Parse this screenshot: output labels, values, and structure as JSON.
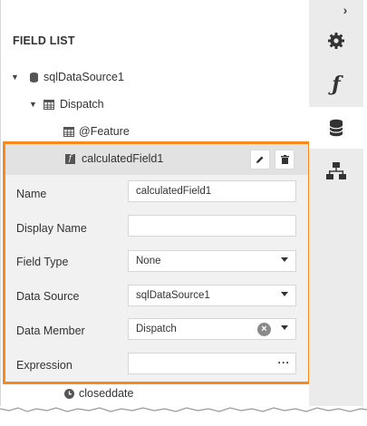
{
  "panel": {
    "title": "FIELD LIST"
  },
  "tree": {
    "datasource": "sqlDataSource1",
    "query": "Dispatch",
    "feature_field": "@Feature",
    "calculated_field": "calculatedField1",
    "closeddate_field": "closeddate"
  },
  "editor": {
    "name_label": "Name",
    "name_value": "calculatedField1",
    "display_name_label": "Display Name",
    "display_name_value": "",
    "field_type_label": "Field Type",
    "field_type_value": "None",
    "data_source_label": "Data Source",
    "data_source_value": "sqlDataSource1",
    "data_member_label": "Data Member",
    "data_member_value": "Dispatch",
    "expression_label": "Expression",
    "expression_value": "",
    "ellipsis": "···"
  },
  "sidebar": {
    "collapse_glyph": "›",
    "items": [
      "gear-icon",
      "function-icon",
      "database-icon",
      "hierarchy-icon"
    ],
    "active": "database-icon"
  },
  "colors": {
    "highlight": "#f7891e",
    "sidebar": "#ebebeb"
  }
}
